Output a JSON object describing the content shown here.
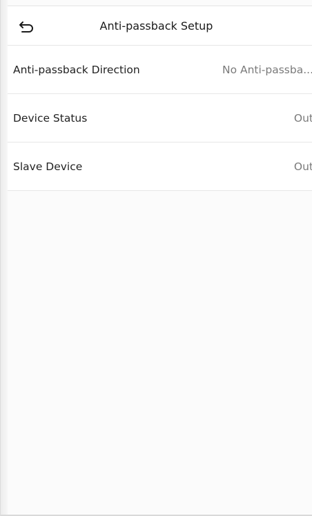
{
  "header": {
    "back_icon": "back-arrow-icon",
    "title": "Anti-passback Setup"
  },
  "settings": {
    "items": [
      {
        "label": "Anti-passback Direction",
        "value": "No Anti-passba..."
      },
      {
        "label": "Device Status",
        "value": "Out"
      },
      {
        "label": "Slave Device",
        "value": "Out"
      }
    ]
  }
}
